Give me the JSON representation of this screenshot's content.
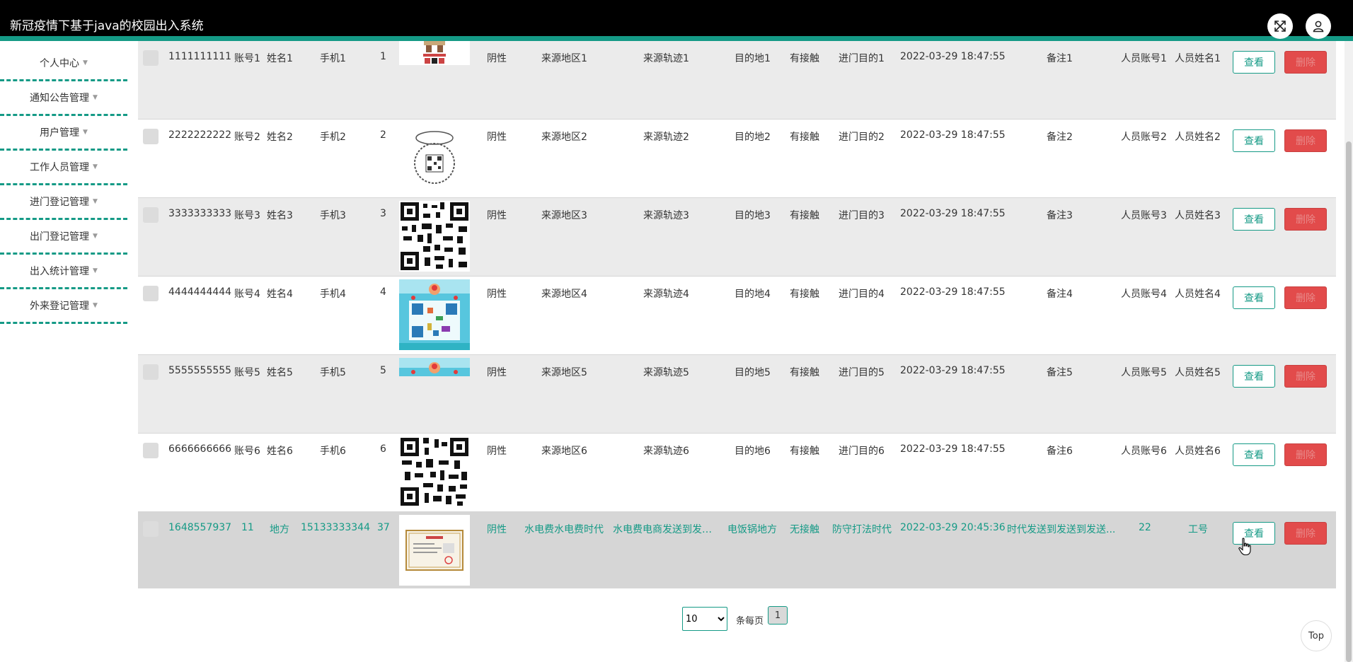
{
  "app": {
    "title": "新冠疫情下基于java的校园出入系统"
  },
  "sidebar": {
    "items": [
      {
        "label": "个人中心"
      },
      {
        "label": "通知公告管理"
      },
      {
        "label": "用户管理"
      },
      {
        "label": "工作人员管理"
      },
      {
        "label": "进门登记管理"
      },
      {
        "label": "出门登记管理"
      },
      {
        "label": "出入统计管理"
      },
      {
        "label": "外来登记管理"
      }
    ]
  },
  "table": {
    "view_label": "查看",
    "delete_label": "删除",
    "rows": [
      {
        "id": "1111111111",
        "account": "账号1",
        "name": "姓名1",
        "phone": "手机1",
        "count": "1",
        "result": "阴性",
        "origin": "来源地区1",
        "track": "来源轨迹1",
        "destination": "目的地1",
        "contact": "有接触",
        "purpose": "进门目的1",
        "time": "2022-03-29 18:47:55",
        "note": "备注1",
        "staff_account": "人员账号1",
        "staff_name": "人员姓名1",
        "image": "qr-cartoon-icon"
      },
      {
        "id": "2222222222",
        "account": "账号2",
        "name": "姓名2",
        "phone": "手机2",
        "count": "2",
        "result": "阴性",
        "origin": "来源地区2",
        "track": "来源轨迹2",
        "destination": "目的地2",
        "contact": "有接触",
        "purpose": "进门目的2",
        "time": "2022-03-29 18:47:55",
        "note": "备注2",
        "staff_account": "人员账号2",
        "staff_name": "人员姓名2",
        "image": "qr-wreath-icon"
      },
      {
        "id": "3333333333",
        "account": "账号3",
        "name": "姓名3",
        "phone": "手机3",
        "count": "3",
        "result": "阴性",
        "origin": "来源地区3",
        "track": "来源轨迹3",
        "destination": "目的地3",
        "contact": "有接触",
        "purpose": "进门目的3",
        "time": "2022-03-29 18:47:55",
        "note": "备注3",
        "staff_account": "人员账号3",
        "staff_name": "人员姓名3",
        "image": "qr-code-icon"
      },
      {
        "id": "4444444444",
        "account": "账号4",
        "name": "姓名4",
        "phone": "手机4",
        "count": "4",
        "result": "阴性",
        "origin": "来源地区4",
        "track": "来源轨迹4",
        "destination": "目的地4",
        "contact": "有接触",
        "purpose": "进门目的4",
        "time": "2022-03-29 18:47:55",
        "note": "备注4",
        "staff_account": "人员账号4",
        "staff_name": "人员姓名4",
        "image": "qr-colorful-icon"
      },
      {
        "id": "5555555555",
        "account": "账号5",
        "name": "姓名5",
        "phone": "手机5",
        "count": "5",
        "result": "阴性",
        "origin": "来源地区5",
        "track": "来源轨迹5",
        "destination": "目的地5",
        "contact": "有接触",
        "purpose": "进门目的5",
        "time": "2022-03-29 18:47:55",
        "note": "备注5",
        "staff_account": "人员账号5",
        "staff_name": "人员姓名5",
        "image": "qr-colorful-partial-icon"
      },
      {
        "id": "6666666666",
        "account": "账号6",
        "name": "姓名6",
        "phone": "手机6",
        "count": "6",
        "result": "阴性",
        "origin": "来源地区6",
        "track": "来源轨迹6",
        "destination": "目的地6",
        "contact": "有接触",
        "purpose": "进门目的6",
        "time": "2022-03-29 18:47:55",
        "note": "备注6",
        "staff_account": "人员账号6",
        "staff_name": "人员姓名6",
        "image": "qr-code-icon"
      },
      {
        "id": "1648557937",
        "account": "11",
        "name": "地方",
        "phone": "15133333344",
        "count": "37",
        "result": "阴性",
        "origin": "水电费水电费时代",
        "track": "水电费电商发送到发多...",
        "destination": "电饭锅地方",
        "contact": "无接触",
        "purpose": "防守打法时代",
        "time": "2022-03-29 20:45:36",
        "note": "时代发送到发送到发送...",
        "staff_account": "22",
        "staff_name": "工号",
        "image": "certificate-icon"
      }
    ]
  },
  "pagination": {
    "page_size": "10",
    "page_size_options": [
      "10"
    ],
    "per_page_label": "条每页",
    "current_page": "1"
  },
  "back_to_top": {
    "label": "Top"
  },
  "colors": {
    "accent": "#159a86",
    "danger": "#e24b4b",
    "header": "#000000"
  }
}
